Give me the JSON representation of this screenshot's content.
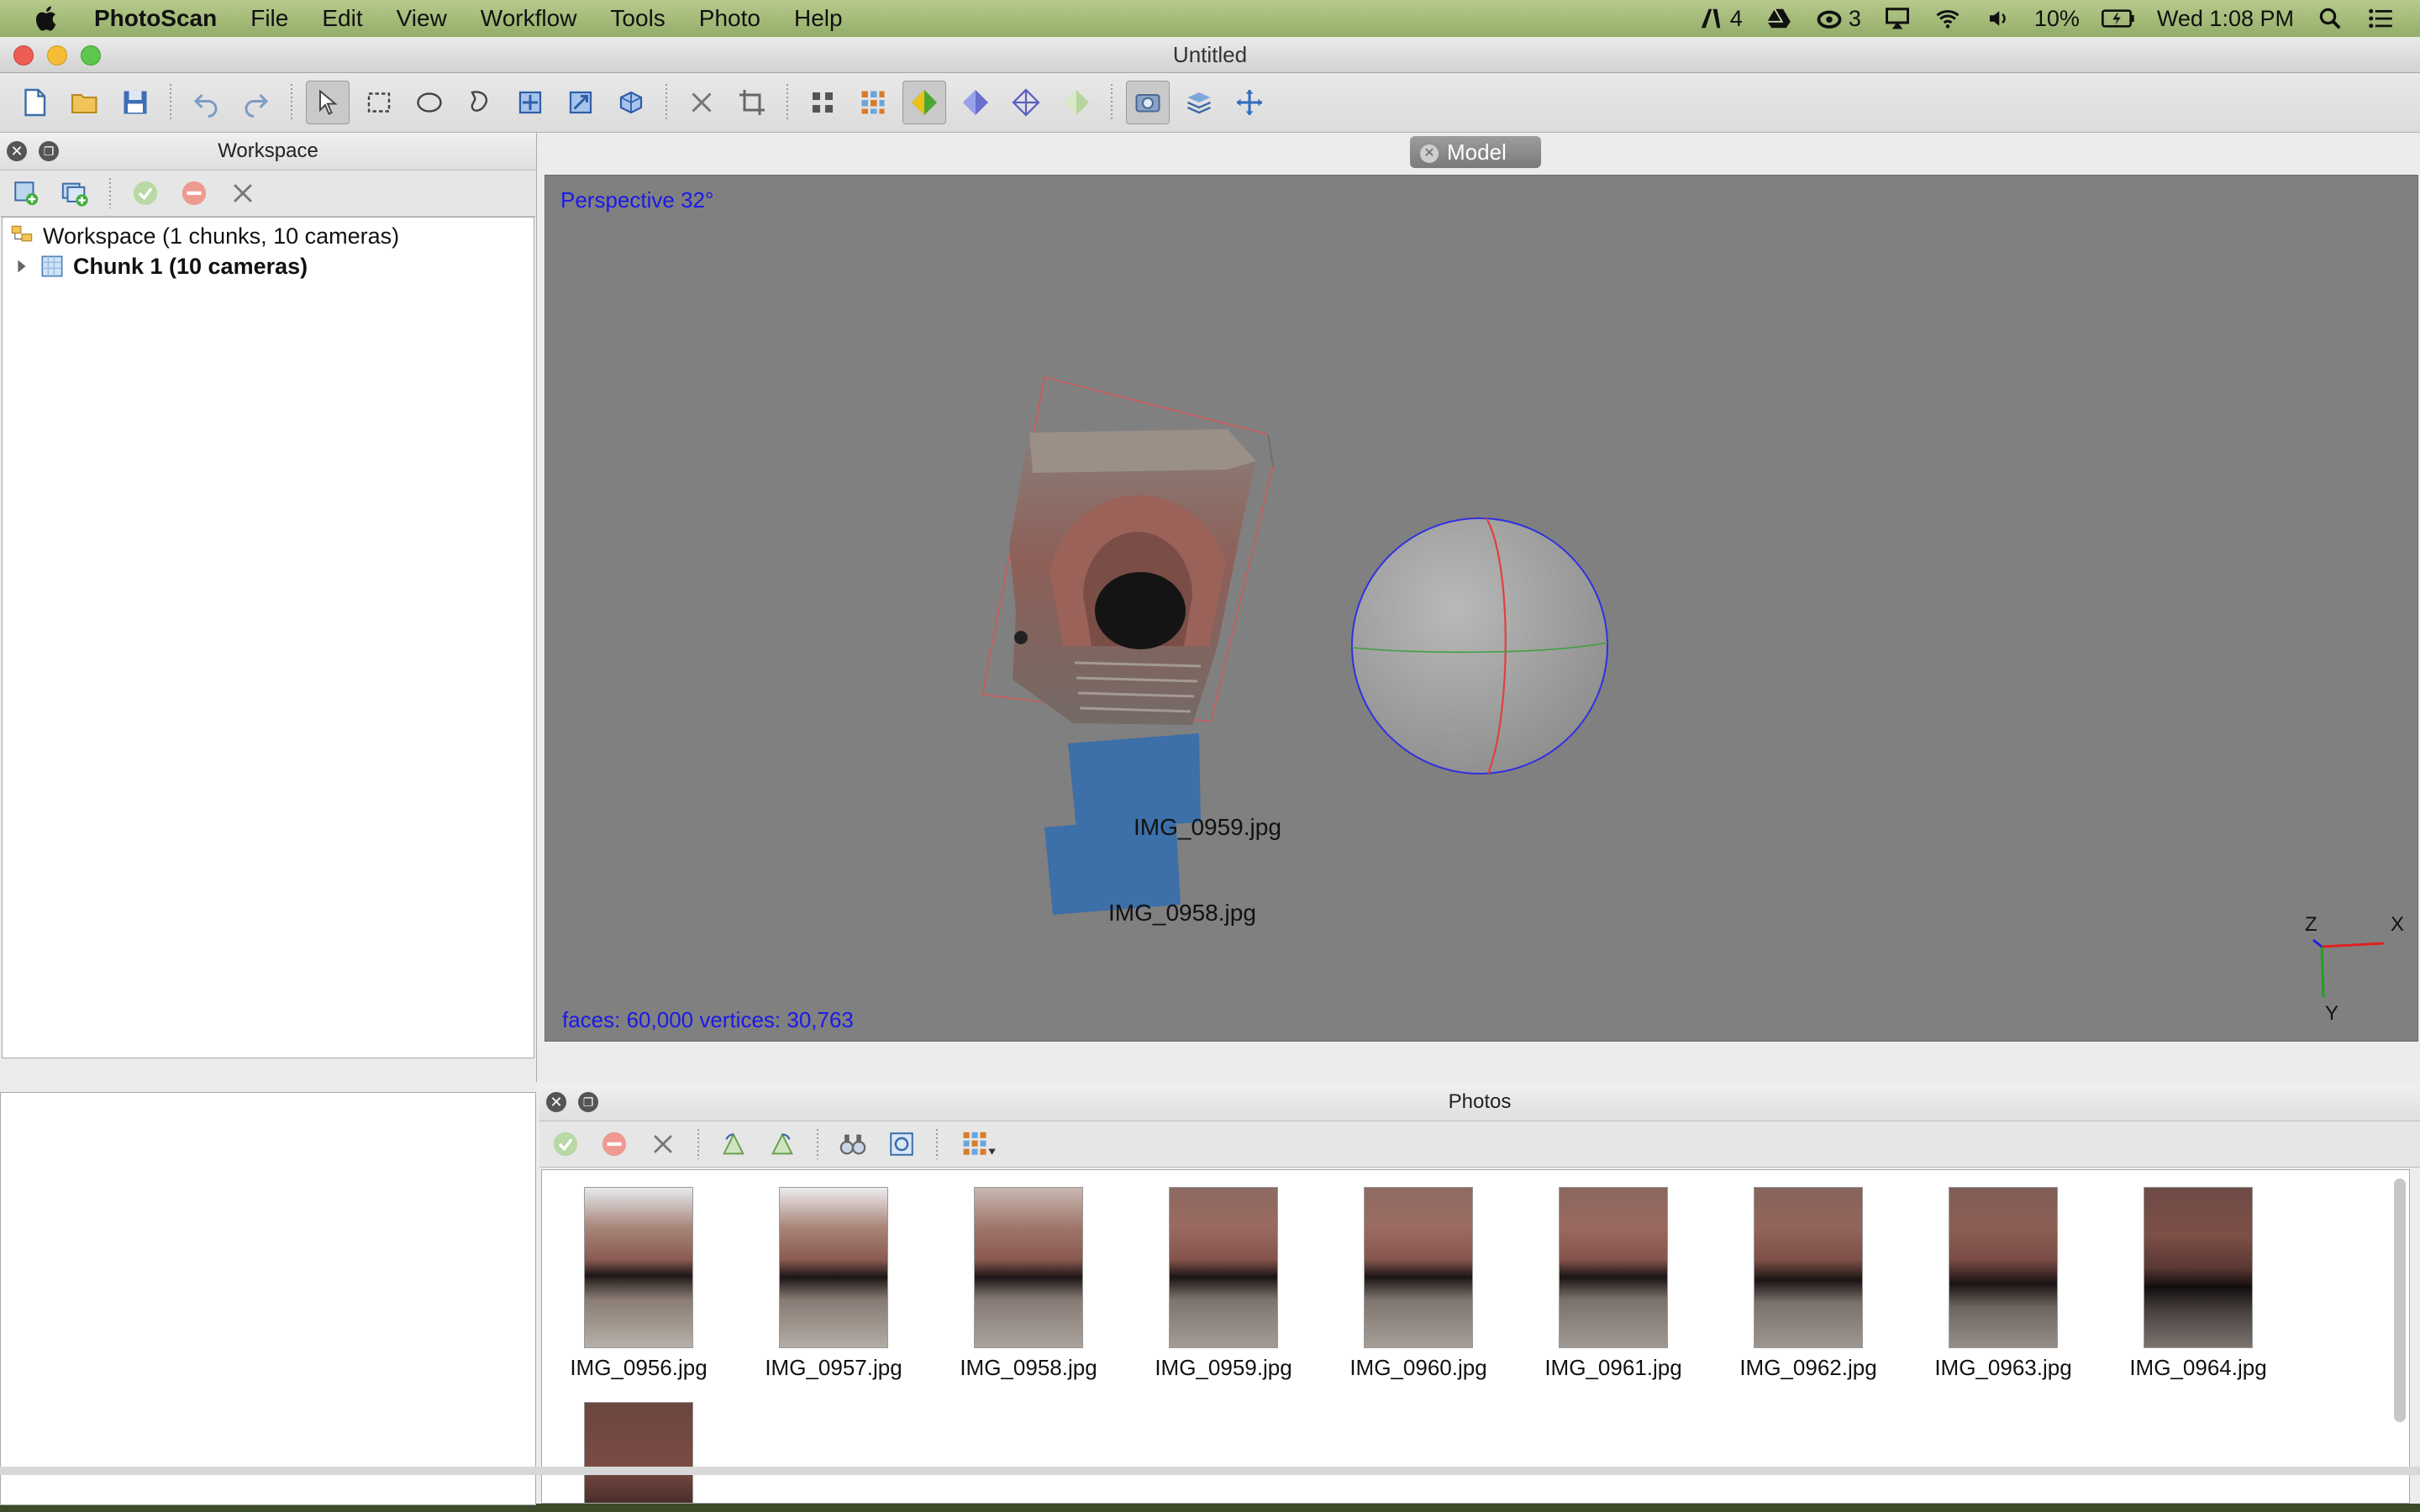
{
  "menubar": {
    "app_name": "PhotoScan",
    "items": [
      "File",
      "Edit",
      "View",
      "Workflow",
      "Tools",
      "Photo",
      "Help"
    ],
    "adobe_count": "4",
    "cc_count": "3",
    "battery": "10%",
    "clock": "Wed 1:08 PM"
  },
  "window": {
    "title": "Untitled"
  },
  "workspace": {
    "header": "Workspace",
    "root": "Workspace (1 chunks, 10 cameras)",
    "chunk": "Chunk 1 (10 cameras)"
  },
  "model": {
    "tab": "Model",
    "perspective": "Perspective 32°",
    "stats": "faces: 60,000 vertices: 30,763",
    "cameras": [
      "IMG_0959.jpg",
      "IMG_0958.jpg"
    ],
    "axes": {
      "z": "Z",
      "x": "X",
      "y": "Y"
    }
  },
  "photos": {
    "header": "Photos",
    "items": [
      "IMG_0956.jpg",
      "IMG_0957.jpg",
      "IMG_0958.jpg",
      "IMG_0959.jpg",
      "IMG_0960.jpg",
      "IMG_0961.jpg",
      "IMG_0962.jpg",
      "IMG_0963.jpg",
      "IMG_0964.jpg"
    ]
  },
  "colors": {
    "overlay_text": "#1a1ae6",
    "camera_plane": "#3d6fa8",
    "viewport_bg": "#808080"
  }
}
